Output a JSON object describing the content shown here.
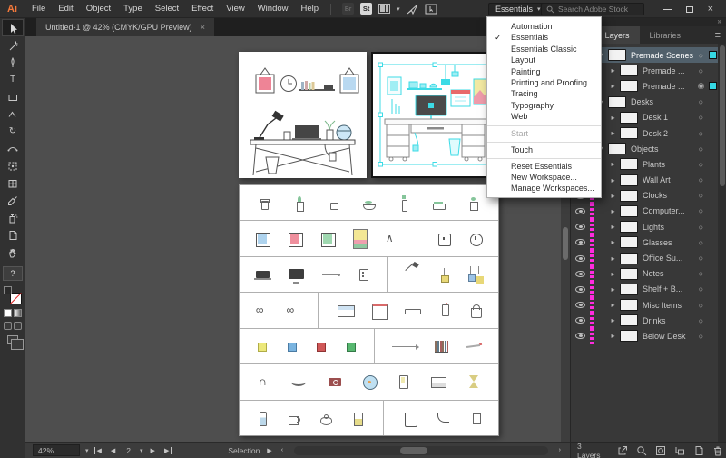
{
  "menu_bar": {
    "logo": "Ai",
    "menus": [
      "File",
      "Edit",
      "Object",
      "Type",
      "Select",
      "Effect",
      "View",
      "Window",
      "Help"
    ],
    "bridge_label": "Br",
    "stock_label": "St",
    "icon_names": [
      "bridge-button",
      "stock-button",
      "arrange-documents-button",
      "share-button",
      "touch-workspace-button"
    ],
    "workspace_button_label": "Essentials",
    "search_placeholder": "Search Adobe Stock"
  },
  "workspace_menu": {
    "items": [
      {
        "label": "Automation"
      },
      {
        "label": "Essentials",
        "checked": true
      },
      {
        "label": "Essentials Classic"
      },
      {
        "label": "Layout"
      },
      {
        "label": "Painting"
      },
      {
        "label": "Printing and Proofing"
      },
      {
        "label": "Tracing"
      },
      {
        "label": "Typography"
      },
      {
        "label": "Web"
      },
      {
        "label": "Start",
        "disabled": true,
        "sep_before": true
      },
      {
        "label": "Touch",
        "sep_before": true
      },
      {
        "label": "Reset Essentials",
        "sep_before": true
      },
      {
        "label": "New Workspace..."
      },
      {
        "label": "Manage Workspaces..."
      }
    ]
  },
  "document_tab": {
    "title": "Untitled-1 @ 42% (CMYK/GPU Preview)",
    "close": "×"
  },
  "toolbar": {
    "tools": [
      "selection-tool",
      "direct-selection-tool",
      "pen-tool",
      "type-tool",
      "rectangle-tool",
      "shaper-tool",
      "rotate-tool",
      "width-tool",
      "free-transform-tool",
      "mesh-tool",
      "eyedropper-tool",
      "symbol-sprayer-tool",
      "artboard-tool",
      "hand-tool",
      "edit-toolbar"
    ],
    "type_tool_glyph": "T",
    "rotate_tool_glyph": "↻",
    "edit_toolbar_glyph": "?"
  },
  "canvas": {
    "sheet": {
      "r1": [
        "jar",
        "plant-tall",
        "jar-small",
        "bowl-plant",
        "bottle-plant",
        "planter",
        "jar-plant"
      ],
      "r2": [
        "frame-blue",
        "frame-red",
        "frame-green",
        "picture-landscape",
        "mountain",
        "divider",
        "clock-square",
        "clock-round"
      ],
      "r3": [
        "laptop",
        "monitor",
        "cable",
        "outlet",
        "divider",
        "desk-lamp",
        "pendant-lamp",
        "pendant-double"
      ],
      "r4": [
        "glasses",
        "glasses",
        "divider",
        "storage-box",
        "calendar",
        "tray",
        "phone",
        "bag"
      ],
      "r5": [
        "note-yellow",
        "note-blue",
        "note-red",
        "note-green",
        "divider",
        "shelf-arrow",
        "book-row",
        "pen"
      ],
      "r6": [
        "headphones",
        "hand-swoosh",
        "camera",
        "fishbowl",
        "phone-small",
        "laptop-open",
        "hourglass"
      ],
      "r7": [
        "bottle",
        "mug",
        "teapot",
        "cup-drink",
        "divider",
        "trash-bin",
        "cable-curve",
        "outlet-small"
      ]
    }
  },
  "layers_panel": {
    "collapse_chevrons": "»",
    "tabs": [
      {
        "label": "s"
      },
      {
        "label": "Layers",
        "active": true
      },
      {
        "label": "Libraries"
      }
    ],
    "rows": [
      {
        "name": "Premade Scenes",
        "chev": "▾",
        "color": "#29d8e6",
        "selected": true,
        "target": "○",
        "chip": true
      },
      {
        "name": "Premade ...",
        "chev": "▸",
        "color": "#29d8e6",
        "sub": true,
        "target": "○"
      },
      {
        "name": "Premade ...",
        "chev": "▸",
        "color": "#29d8e6",
        "sub": true,
        "target": "◉",
        "chip": true
      },
      {
        "name": "Desks",
        "chev": "▾",
        "color": "#e8e619",
        "target": "○"
      },
      {
        "name": "Desk 1",
        "chev": "▸",
        "color": "#e8e619",
        "sub": true,
        "target": "○"
      },
      {
        "name": "Desk 2",
        "chev": "▸",
        "color": "#e8e619",
        "sub": true,
        "target": "○"
      },
      {
        "name": "Objects",
        "chev": "▾",
        "color": "#ff2bdf",
        "target": "○"
      },
      {
        "name": "Plants",
        "chev": "▸",
        "color": "#ff2bdf",
        "sub": true,
        "target": "○"
      },
      {
        "name": "Wall Art",
        "chev": "▸",
        "color": "#ff2bdf",
        "sub": true,
        "target": "○"
      },
      {
        "name": "Clocks",
        "chev": "▸",
        "color": "#ff2bdf",
        "sub": true,
        "target": "○"
      },
      {
        "name": "Computer...",
        "chev": "▸",
        "color": "#ff2bdf",
        "sub": true,
        "target": "○"
      },
      {
        "name": "Lights",
        "chev": "▸",
        "color": "#ff2bdf",
        "sub": true,
        "target": "○"
      },
      {
        "name": "Glasses",
        "chev": "▸",
        "color": "#ff2bdf",
        "sub": true,
        "target": "○"
      },
      {
        "name": "Office Su...",
        "chev": "▸",
        "color": "#ff2bdf",
        "sub": true,
        "target": "○"
      },
      {
        "name": "Notes",
        "chev": "▸",
        "color": "#ff2bdf",
        "sub": true,
        "target": "○"
      },
      {
        "name": "Shelf + B...",
        "chev": "▸",
        "color": "#ff2bdf",
        "sub": true,
        "target": "○"
      },
      {
        "name": "Misc Items",
        "chev": "▸",
        "color": "#ff2bdf",
        "sub": true,
        "target": "○"
      },
      {
        "name": "Drinks",
        "chev": "▸",
        "color": "#ff2bdf",
        "sub": true,
        "target": "○"
      },
      {
        "name": "Below Desk",
        "chev": "▸",
        "color": "#ff2bdf",
        "sub": true,
        "target": "○"
      }
    ],
    "footer": {
      "count_label": "3 Layers",
      "button_names": [
        "collect-for-export-button",
        "locate-object-button",
        "clipping-mask-button",
        "new-sublayer-button",
        "new-layer-button",
        "delete-layer-button"
      ]
    }
  },
  "status_bar": {
    "zoom_level": "42%",
    "artboard_number": "2",
    "status_label": "Selection"
  },
  "window_controls": {
    "minimize": "–",
    "maximize": "□",
    "close": "×"
  },
  "colors": {
    "accent_cyan": "#35d8e4",
    "layer_cyan": "#29d8e6",
    "layer_yellow": "#e8e619",
    "layer_magenta": "#ff2bdf",
    "selected_row": "#51606b",
    "canvas_bg": "#4e4e4e",
    "artboard_bg": "#ffffff",
    "logo_orange": "#f4793b"
  }
}
